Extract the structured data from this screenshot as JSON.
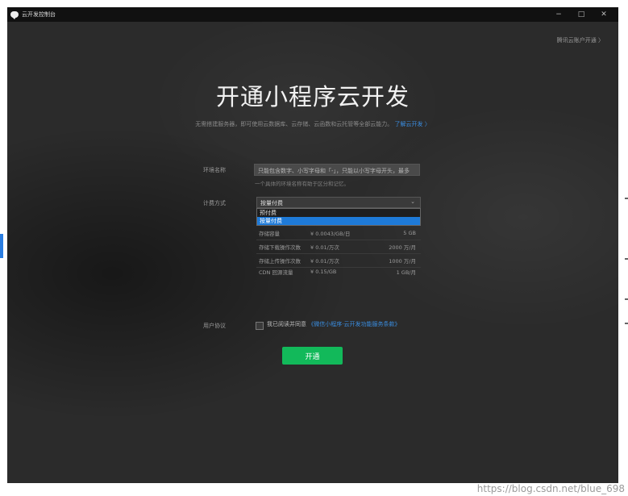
{
  "window": {
    "title": "云开发控制台",
    "controls": [
      "−",
      "□",
      "✕"
    ]
  },
  "account_link": "腾讯云账户开通 〉",
  "headline": "开通小程序云开发",
  "subline": {
    "text": "无需搭建服务器，即可使用云数据库、云存储、云函数和云托管等全部云能力。",
    "learn_more": "了解云开发 〉"
  },
  "form": {
    "env_label": "环境名称",
    "env_value": "只能包含数字、小写字母和「-」，只能以小写字母开头，最多",
    "env_hint": "一个具体的环境名称有助于区分和记忆。",
    "billing_label": "计费方式",
    "billing_selected": "按量付费",
    "billing_options": [
      "预付费",
      "按量付费"
    ],
    "price_rows": [
      {
        "item": "存储容量",
        "price": "¥ 0.0043/GB/日",
        "quota": "5 GB"
      },
      {
        "item": "存储下载操作次数",
        "price": "¥ 0.01/万次",
        "quota": "2000 万/月"
      },
      {
        "item": "存储上传操作次数",
        "price": "¥ 0.01/万次",
        "quota": "1000 万/月"
      },
      {
        "item": "CDN 回源流量",
        "price": "¥ 0.15/GB",
        "quota": "1 GB/月"
      }
    ],
    "agreement_label": "用户协议",
    "agreement_text": "我已阅读并同意",
    "agreement_link": "《微信小程序·云开发功能服务条款》",
    "submit": "开通"
  },
  "watermark": "https://blog.csdn.net/blue_698"
}
